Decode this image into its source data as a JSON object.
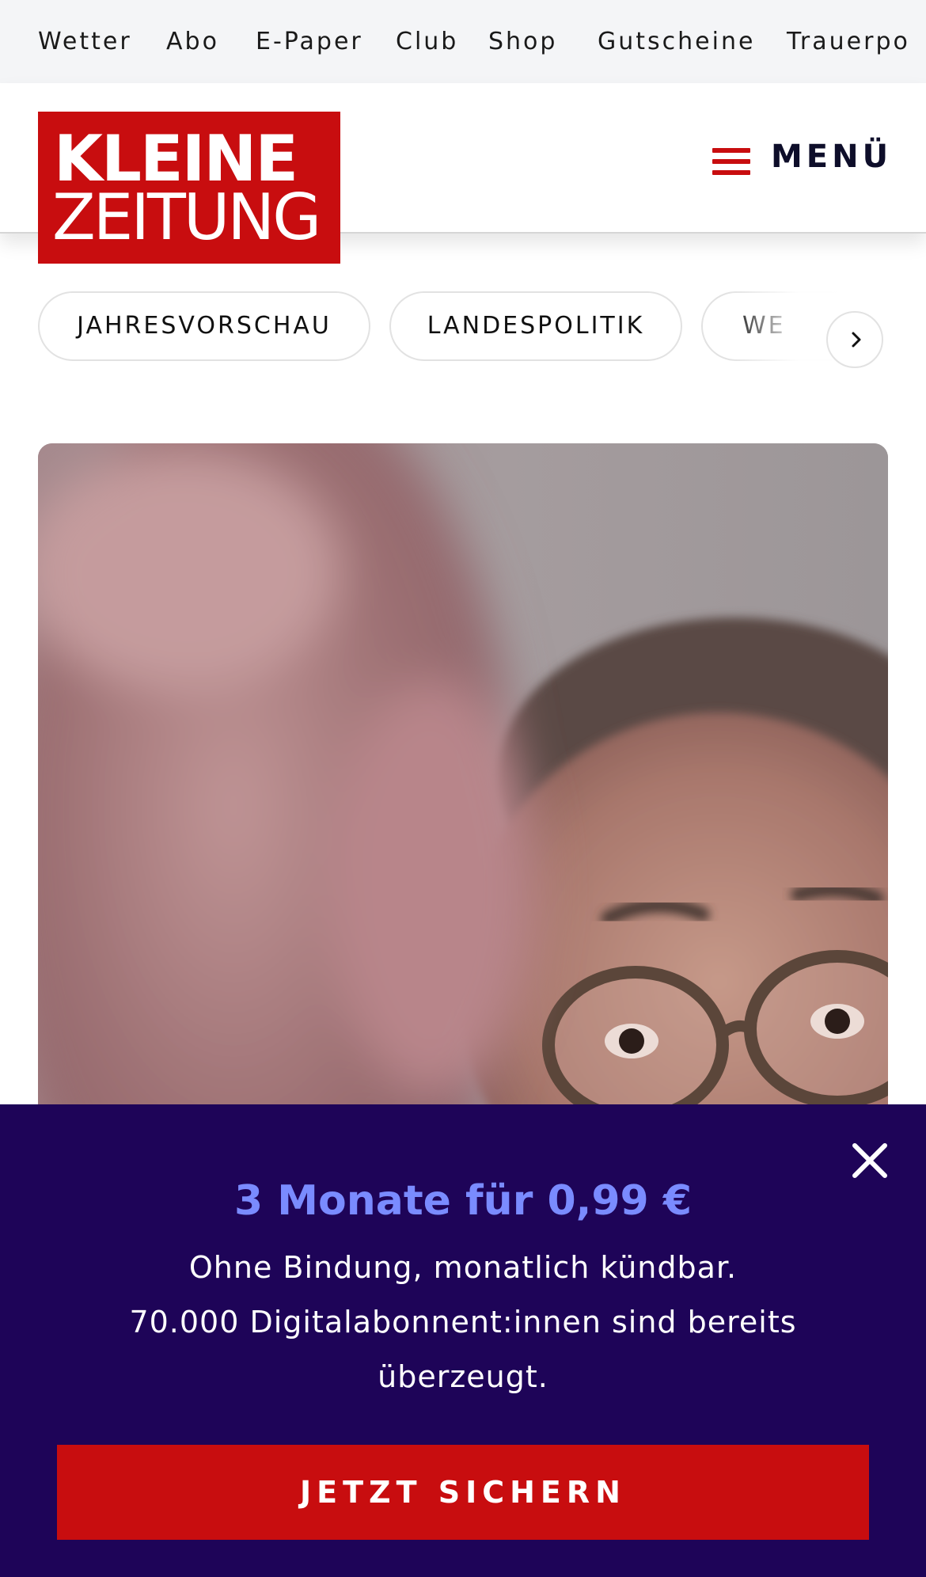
{
  "top_nav": {
    "items": [
      {
        "label": "Wetter"
      },
      {
        "label": "Abo"
      },
      {
        "label": "E-Paper"
      },
      {
        "label": "Club"
      },
      {
        "label": "Shop"
      },
      {
        "label": "Gutscheine"
      },
      {
        "label": "Trauerpo"
      }
    ]
  },
  "header": {
    "logo": {
      "line1": "KLEINE",
      "line2": "ZEITUNG"
    },
    "menu_label": "MENÜ"
  },
  "categories": {
    "pills": [
      {
        "label": "JAHRESVORSCHAU"
      },
      {
        "label": "LANDESPOLITIK"
      },
      {
        "label": "WE"
      }
    ],
    "next_icon": "chevron-right-icon"
  },
  "promo": {
    "headline": "3 Monate für 0,99 €",
    "line1": "Ohne Bindung, monatlich kündbar.",
    "line2": "70.000 Digitalabonnent:innen sind bereits überzeugt.",
    "cta_label": "JETZT SICHERN",
    "close_icon": "close-icon"
  },
  "colors": {
    "brand_red": "#c80d0f",
    "promo_bg": "#1e0458",
    "promo_headline": "#7a8bff"
  }
}
